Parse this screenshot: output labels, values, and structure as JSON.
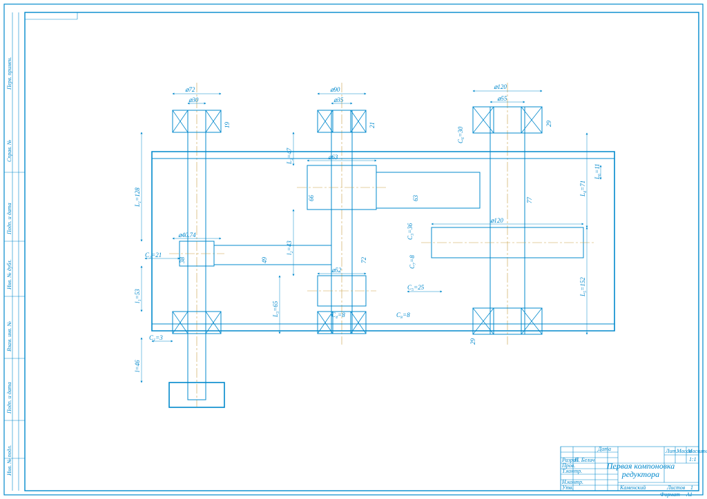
{
  "title_block": {
    "title_line1": "Первая компоновка",
    "title_line2": "редуктора",
    "scale": "1:1",
    "sheet_label": "Листов",
    "sheet_count": "1",
    "format_label": "Формат",
    "format_value": "A1",
    "company": "Каменский",
    "rows": {
      "r1c1": "Разраб.",
      "r1c2": "П. Белич",
      "r1c3": "Дата",
      "r1c4": "Лит.",
      "r1c5": "Масса",
      "r1c6": "Масштаб",
      "r2c1": "Пров.",
      "r3c1": "Т.контр.",
      "r4c1": "Н.контр.",
      "r5c1": "Утв."
    }
  },
  "side_strip": {
    "t1": "Подп. и дата",
    "t2": "Инв. № дубл.",
    "t3": "Взам. инв. №",
    "t4": "Подп. и дата",
    "t5": "Инв. № подл.",
    "t6": "Справ. №",
    "t7": "Перв. примен."
  },
  "dims": {
    "d_top1": "⌀72",
    "d_top1b": "⌀30",
    "d_top2": "⌀90",
    "d_top2b": "⌀35",
    "d_top3": "⌀120",
    "d_top3b": "⌀55",
    "shaft1_len": "L₁=128",
    "shaft1_low": "l₁=53",
    "shaft1_ext": "l=46",
    "shaft2_up": "L₂=47",
    "shaft2_low": "L₃=65",
    "shaft2_mid": "l₂=43",
    "shaft3_up": "L₄=71",
    "shaft3_low": "L₅=152",
    "shaft3_side": "L₆=11",
    "gear_small": "⌀40.74",
    "gear_mid": "⌀63",
    "gear_big": "⌀120",
    "inner_d": "⌀52",
    "b1": "19",
    "b2": "21",
    "b3": "29",
    "b4": "29",
    "h_small": "38",
    "h_mid": "66",
    "h_mid2": "63",
    "h_big": "77",
    "h_g1": "49",
    "h_g2": "72",
    "c1": "C₁=3",
    "c2": "C₂=21",
    "c3": "C₃=36",
    "c4": "C₄=8",
    "c5": "C₅=25",
    "c6": "C₆=30",
    "c7": "C₇=8",
    "c8": "C₈=8"
  }
}
